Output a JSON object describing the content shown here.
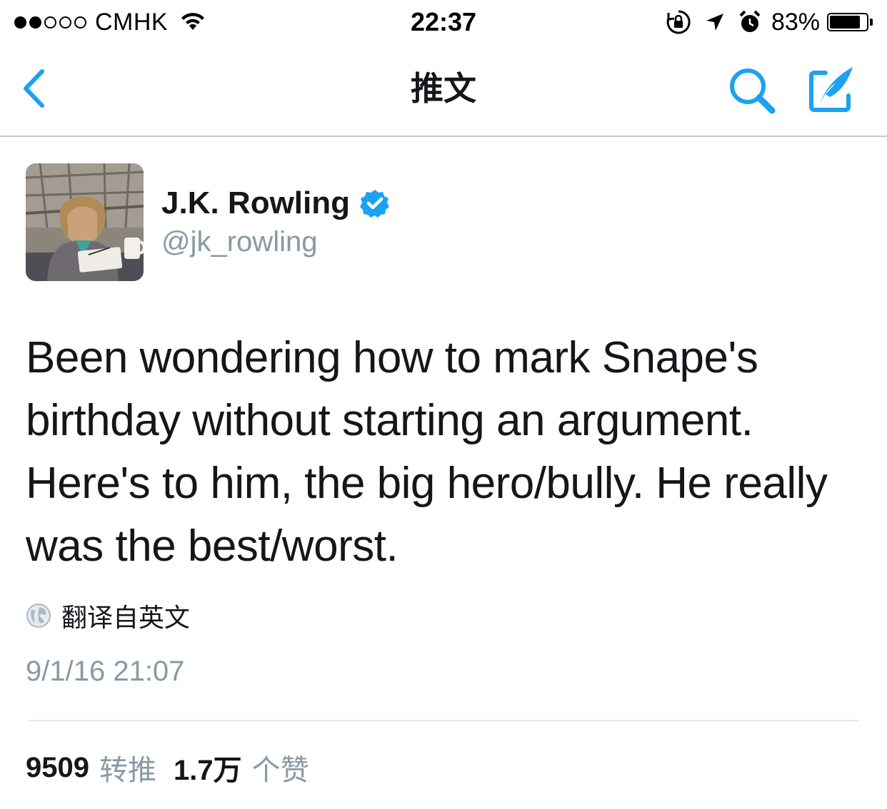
{
  "status_bar": {
    "carrier": "CMHK",
    "time": "22:37",
    "battery_percent": "83%",
    "battery_level": 0.83,
    "signal_bars_filled": 2,
    "signal_bars_total": 5
  },
  "nav": {
    "title": "推文",
    "back_icon": "chevron-left-icon",
    "search_icon": "search-icon",
    "compose_icon": "compose-icon",
    "accent_color": "#1da1f2"
  },
  "tweet": {
    "author_name": "J.K. Rowling",
    "handle": "@jk_rowling",
    "verified": true,
    "text": "Been wondering how to mark Snape's birthday without starting an argument. Here's to him, the big hero/bully. He really was the best/worst.",
    "translate_label": "翻译自英文",
    "timestamp": "9/1/16 21:07",
    "retweet_count": "9509",
    "retweet_label": "转推",
    "like_count": "1.7万",
    "like_label": "个赞"
  },
  "colors": {
    "text_primary": "#14171a",
    "text_secondary": "#8899a6",
    "divider": "#e1e8ed"
  }
}
